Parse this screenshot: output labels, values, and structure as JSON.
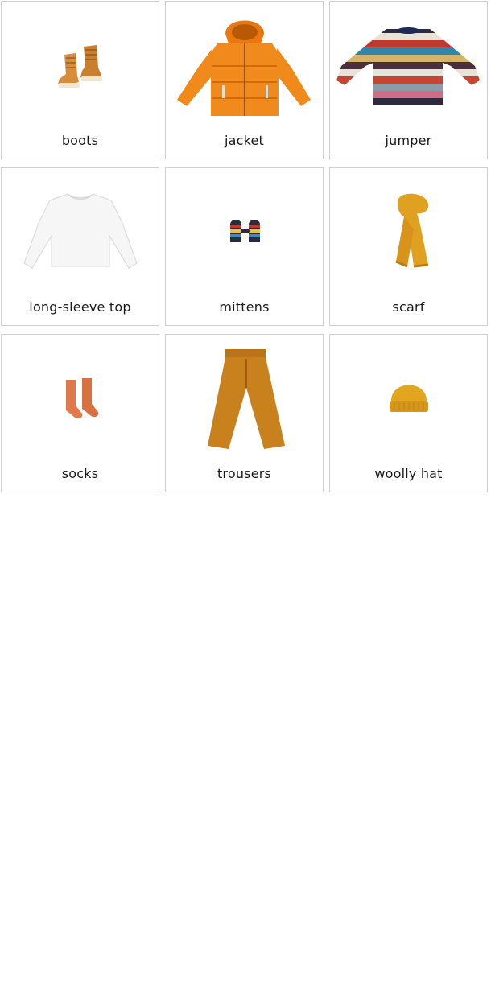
{
  "cards": [
    {
      "label": "boots",
      "icon": "boots-icon"
    },
    {
      "label": "jacket",
      "icon": "jacket-icon"
    },
    {
      "label": "jumper",
      "icon": "jumper-icon"
    },
    {
      "label": "long-sleeve top",
      "icon": "long-sleeve-top-icon"
    },
    {
      "label": "mittens",
      "icon": "mittens-icon"
    },
    {
      "label": "scarf",
      "icon": "scarf-icon"
    },
    {
      "label": "socks",
      "icon": "socks-icon"
    },
    {
      "label": "trousers",
      "icon": "trousers-icon"
    },
    {
      "label": "woolly hat",
      "icon": "woolly-hat-icon"
    }
  ],
  "colors": {
    "card_border": "#cfcfcf",
    "text": "#1a1a1a",
    "boots": "#d98c3a",
    "jacket": "#f18a1c",
    "top": "#f3f3f3",
    "scarf": "#e0a020",
    "socks": "#e07a4c",
    "trousers": "#c8811c",
    "hat": "#e2a51e"
  }
}
